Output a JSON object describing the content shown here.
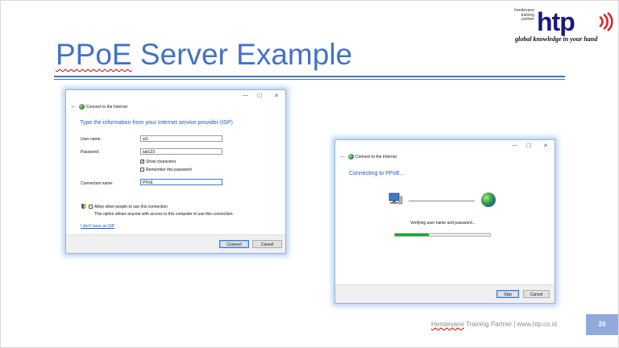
{
  "slide": {
    "title_word1": "PPoE",
    "title_rest": " Server Example",
    "logo": {
      "tagline": [
        "hendevane",
        "training",
        "partner"
      ],
      "brand": "htp",
      "slogan": "global knowledge in your hand"
    },
    "footer_word1": "Hendevane",
    "footer_rest": " Training Partner | www.htp.co.id",
    "page_number": "20",
    "accent_color": "#4472c4"
  },
  "dialog1": {
    "window_controls": [
      "—",
      "☐",
      "✕"
    ],
    "back_glyph": "←",
    "title": "Connect to the Internet",
    "heading": "Type the information from your Internet service provider (ISP)",
    "username_label": "User name:",
    "username_value": "st1",
    "password_label": "Password:",
    "password_value": "lab123",
    "show_characters": "Show characters",
    "show_characters_checked": true,
    "remember_password": "Remember this password",
    "remember_password_checked": false,
    "connection_name_label": "Connection name:",
    "connection_name_value": "PPoE",
    "allow_other_people": "Allow other people to use this connection",
    "allow_other_people_note": "This option allows anyone with access to this computer to use this connection.",
    "no_isp_link": "I don't have an ISP",
    "connect_button": "Connect",
    "cancel_button": "Cancel"
  },
  "dialog2": {
    "window_controls": [
      "—",
      "☐",
      "✕"
    ],
    "back_glyph": "←",
    "title": "Connect to the Internet",
    "heading": "Connecting to PPoE...",
    "status": "Verifying user name and password...",
    "progress_fraction": 0.36,
    "skip_button": "Skip",
    "cancel_button": "Cancel"
  }
}
